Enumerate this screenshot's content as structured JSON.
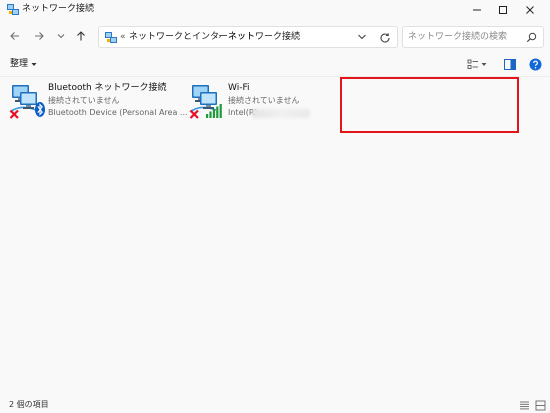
{
  "window": {
    "title": "ネットワーク接続"
  },
  "address": {
    "separator_first": "«",
    "crumbs": [
      "ネットワークとインターネット",
      "ネットワーク接続"
    ],
    "separator": "›"
  },
  "search": {
    "placeholder": "ネットワーク接続の検索"
  },
  "toolbar": {
    "organize_label": "整理"
  },
  "items": [
    {
      "name": "Bluetooth ネットワーク接続",
      "status": "接続されていません",
      "device": "Bluetooth Device (Personal Area ...",
      "icon": "bluetooth-network-adapter-icon",
      "state": "disconnected"
    },
    {
      "name": "Wi-Fi",
      "status": "接続されていません",
      "device": "Intel(R)",
      "icon": "wifi-network-adapter-icon",
      "state": "disconnected"
    }
  ],
  "status_bar": {
    "item_count": "2 個の項目"
  },
  "colors": {
    "background": "#f9f9f9",
    "highlight_box": "#e4141b",
    "error_x": "#e81123",
    "bluetooth": "#0a5cc7",
    "wifi_bars": "#1e9a3b",
    "help": "#1168d8"
  }
}
